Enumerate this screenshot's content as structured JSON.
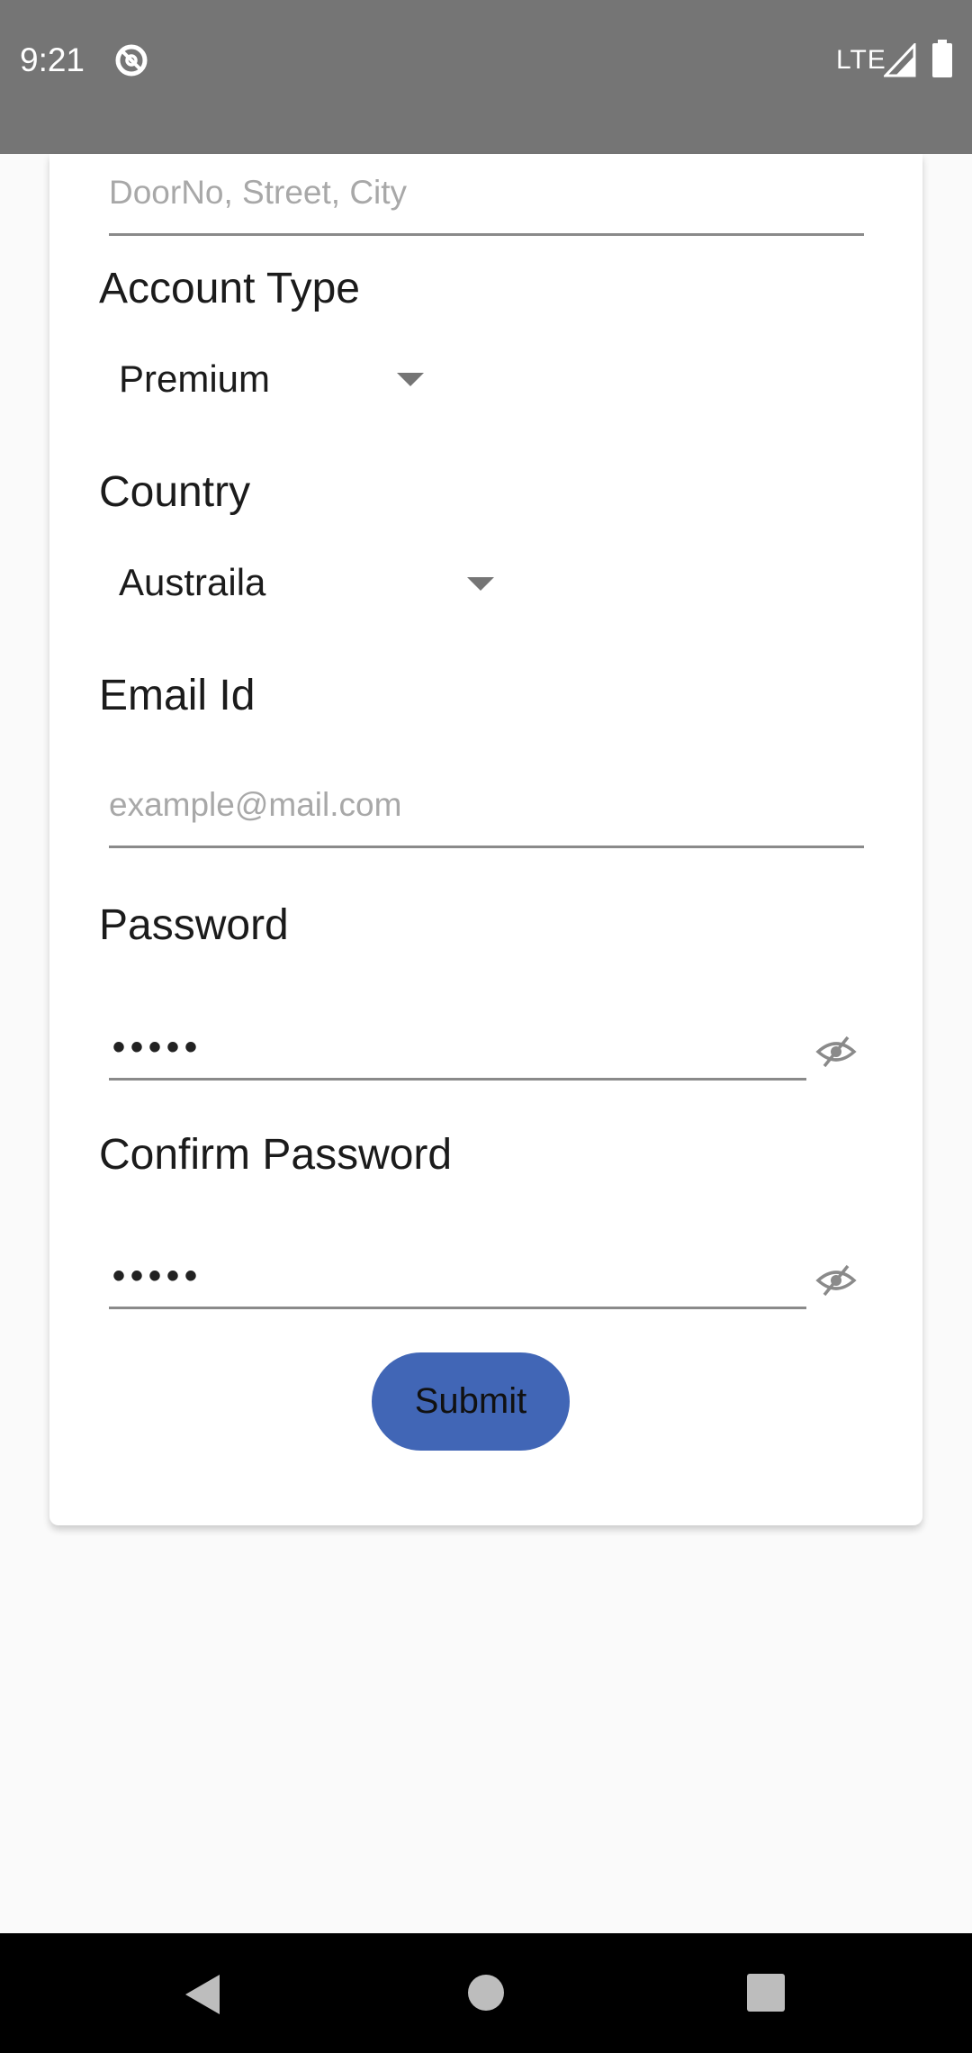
{
  "status_bar": {
    "time": "9:21",
    "network": "LTE",
    "icons": [
      "do-not-disturb-icon",
      "signal-icon",
      "battery-icon"
    ]
  },
  "form": {
    "address_placeholder": "DoorNo, Street, City",
    "account_type": {
      "label": "Account Type",
      "selected": "Premium"
    },
    "country": {
      "label": "Country",
      "selected": "Austraila"
    },
    "email": {
      "label": "Email Id",
      "placeholder": "example@mail.com"
    },
    "password": {
      "label": "Password",
      "value": "•••••"
    },
    "confirm_password": {
      "label": "Confirm Password",
      "value": "•••••"
    },
    "submit_label": "Submit"
  },
  "colors": {
    "status_bar": "#757575",
    "submit_button": "#4166b6",
    "nav_bar": "#000000"
  },
  "nav_bar": {
    "icons": [
      "back-icon",
      "home-icon",
      "recents-icon"
    ]
  }
}
